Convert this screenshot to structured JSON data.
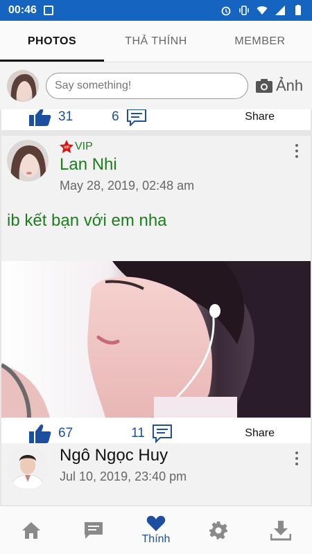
{
  "status": {
    "time": "00:46"
  },
  "tabs": [
    {
      "label": "PHOTOS",
      "active": true
    },
    {
      "label": "THẢ THÍNH",
      "active": false
    },
    {
      "label": "MEMBER",
      "active": false
    }
  ],
  "composer": {
    "placeholder": "Say something!",
    "photo_label": "Ảnh"
  },
  "prev_post": {
    "likes": "31",
    "comments": "6",
    "share_label": "Share"
  },
  "post1": {
    "badge": "VIP",
    "author": "Lan Nhi",
    "author_color": "#1a7f1a",
    "date": "May 28, 2019, 02:48 am",
    "text": "ib kết bạn với em nha",
    "likes": "67",
    "comments": "11",
    "share_label": "Share"
  },
  "post2": {
    "author": "Ngô Ngọc Huy",
    "author_color": "#111111",
    "date": "Jul 10, 2019, 23:40 pm"
  },
  "bottom_nav": [
    {
      "icon": "home-icon",
      "label": ""
    },
    {
      "icon": "chat-icon",
      "label": ""
    },
    {
      "icon": "heart-icon",
      "label": "Thính",
      "active": true
    },
    {
      "icon": "gear-icon",
      "label": ""
    },
    {
      "icon": "download-icon",
      "label": ""
    }
  ],
  "colors": {
    "accent": "#1565c0",
    "link": "#1d4fa0",
    "vip_green": "#1a7f1a"
  }
}
